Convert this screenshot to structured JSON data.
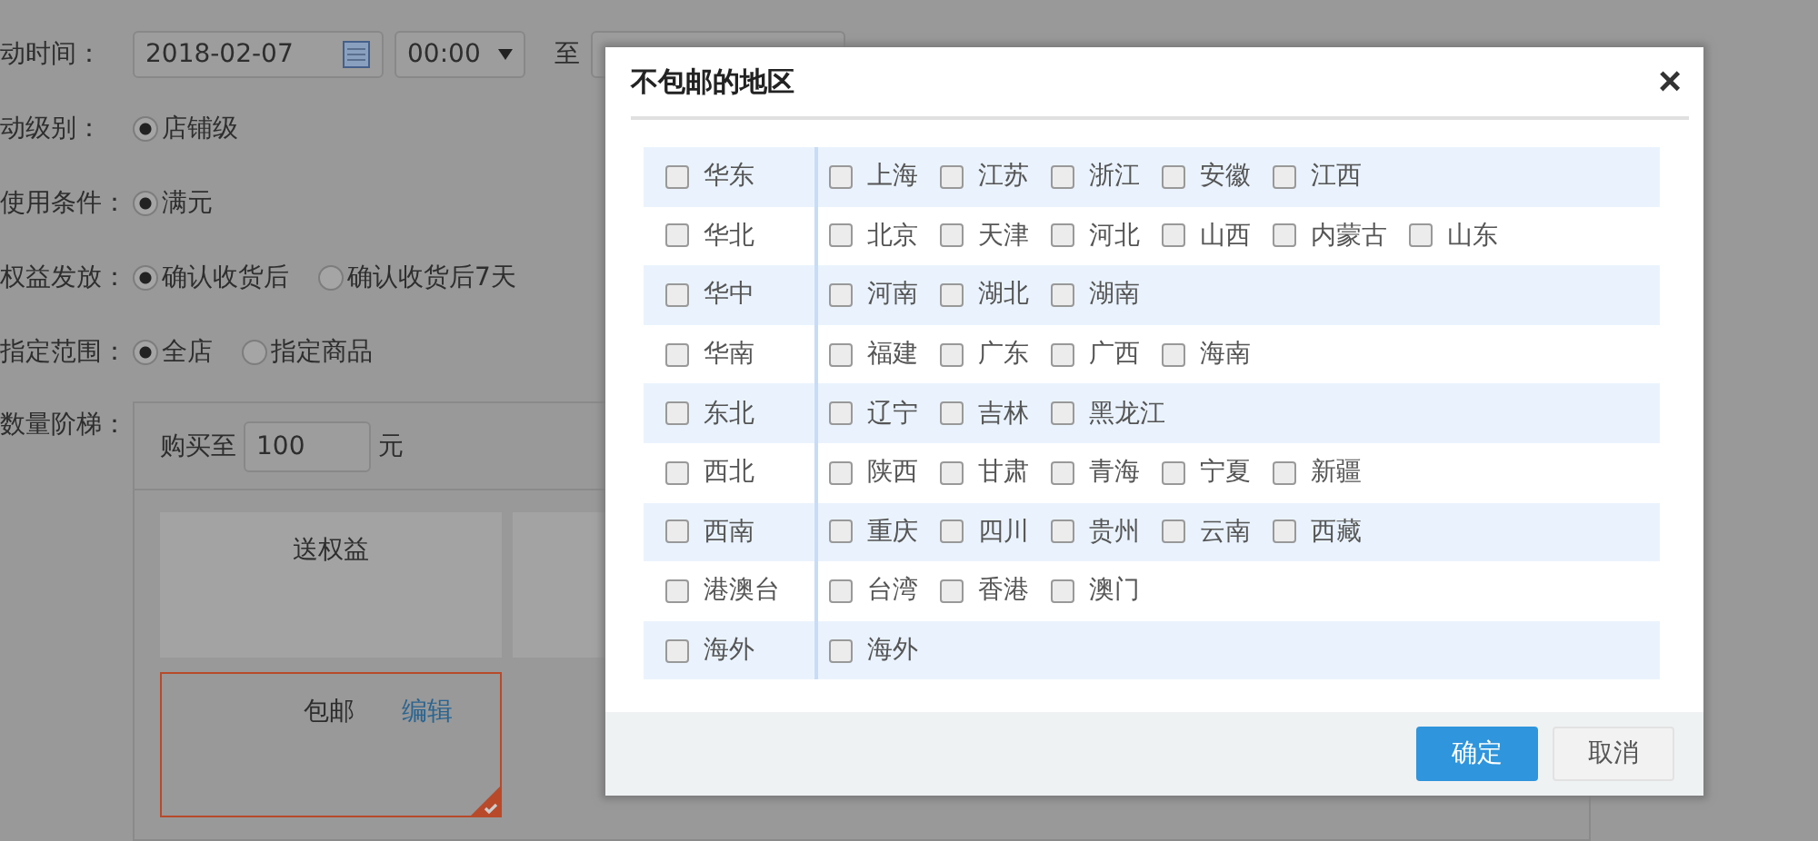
{
  "form": {
    "time": {
      "label": "动时间：",
      "start_date": "2018-02-07",
      "start_time": "00:00",
      "to": "至"
    },
    "radio_rows": [
      {
        "label": "动级别：",
        "options": [
          {
            "text": "店铺级",
            "selected": true
          }
        ]
      },
      {
        "label": "使用条件：",
        "options": [
          {
            "text": "满元",
            "selected": true
          }
        ]
      },
      {
        "label": "权益发放：",
        "options": [
          {
            "text": "确认收货后",
            "selected": true
          },
          {
            "text": "确认收货后7天",
            "selected": false
          }
        ]
      },
      {
        "label": "指定范围：",
        "options": [
          {
            "text": "全店",
            "selected": true
          },
          {
            "text": "指定商品",
            "selected": false
          }
        ]
      }
    ],
    "ladder": {
      "label": "数量阶梯：",
      "buy_to": "购买至",
      "amount": "100",
      "unit": "元",
      "benefit_card": "送权益",
      "item": {
        "name": "包邮",
        "edit": "编辑",
        "selected": true
      }
    }
  },
  "dialog": {
    "title": "不包邮的地区",
    "close": "×",
    "regions": [
      {
        "name": "华东",
        "checked": false,
        "provinces": [
          {
            "name": "上海",
            "checked": false
          },
          {
            "name": "江苏",
            "checked": false
          },
          {
            "name": "浙江",
            "checked": false
          },
          {
            "name": "安徽",
            "checked": false
          },
          {
            "name": "江西",
            "checked": false
          }
        ]
      },
      {
        "name": "华北",
        "checked": false,
        "provinces": [
          {
            "name": "北京",
            "checked": false
          },
          {
            "name": "天津",
            "checked": false
          },
          {
            "name": "河北",
            "checked": false
          },
          {
            "name": "山西",
            "checked": false
          },
          {
            "name": "内蒙古",
            "checked": false
          },
          {
            "name": "山东",
            "checked": false
          }
        ]
      },
      {
        "name": "华中",
        "checked": false,
        "provinces": [
          {
            "name": "河南",
            "checked": false
          },
          {
            "name": "湖北",
            "checked": false
          },
          {
            "name": "湖南",
            "checked": false
          }
        ]
      },
      {
        "name": "华南",
        "checked": false,
        "provinces": [
          {
            "name": "福建",
            "checked": false
          },
          {
            "name": "广东",
            "checked": false
          },
          {
            "name": "广西",
            "checked": false
          },
          {
            "name": "海南",
            "checked": false
          }
        ]
      },
      {
        "name": "东北",
        "checked": false,
        "provinces": [
          {
            "name": "辽宁",
            "checked": false
          },
          {
            "name": "吉林",
            "checked": false
          },
          {
            "name": "黑龙江",
            "checked": false
          }
        ]
      },
      {
        "name": "西北",
        "checked": false,
        "provinces": [
          {
            "name": "陕西",
            "checked": false
          },
          {
            "name": "甘肃",
            "checked": false
          },
          {
            "name": "青海",
            "checked": false
          },
          {
            "name": "宁夏",
            "checked": false
          },
          {
            "name": "新疆",
            "checked": false
          }
        ]
      },
      {
        "name": "西南",
        "checked": false,
        "provinces": [
          {
            "name": "重庆",
            "checked": false
          },
          {
            "name": "四川",
            "checked": false
          },
          {
            "name": "贵州",
            "checked": false
          },
          {
            "name": "云南",
            "checked": false
          },
          {
            "name": "西藏",
            "checked": false
          }
        ]
      },
      {
        "name": "港澳台",
        "checked": false,
        "provinces": [
          {
            "name": "台湾",
            "checked": false
          },
          {
            "name": "香港",
            "checked": false
          },
          {
            "name": "澳门",
            "checked": false
          }
        ]
      },
      {
        "name": "海外",
        "checked": false,
        "provinces": [
          {
            "name": "海外",
            "checked": false
          }
        ]
      }
    ],
    "buttons": [
      {
        "label": "确定",
        "kind": "primary"
      },
      {
        "label": "取消",
        "kind": "secondary"
      }
    ]
  }
}
